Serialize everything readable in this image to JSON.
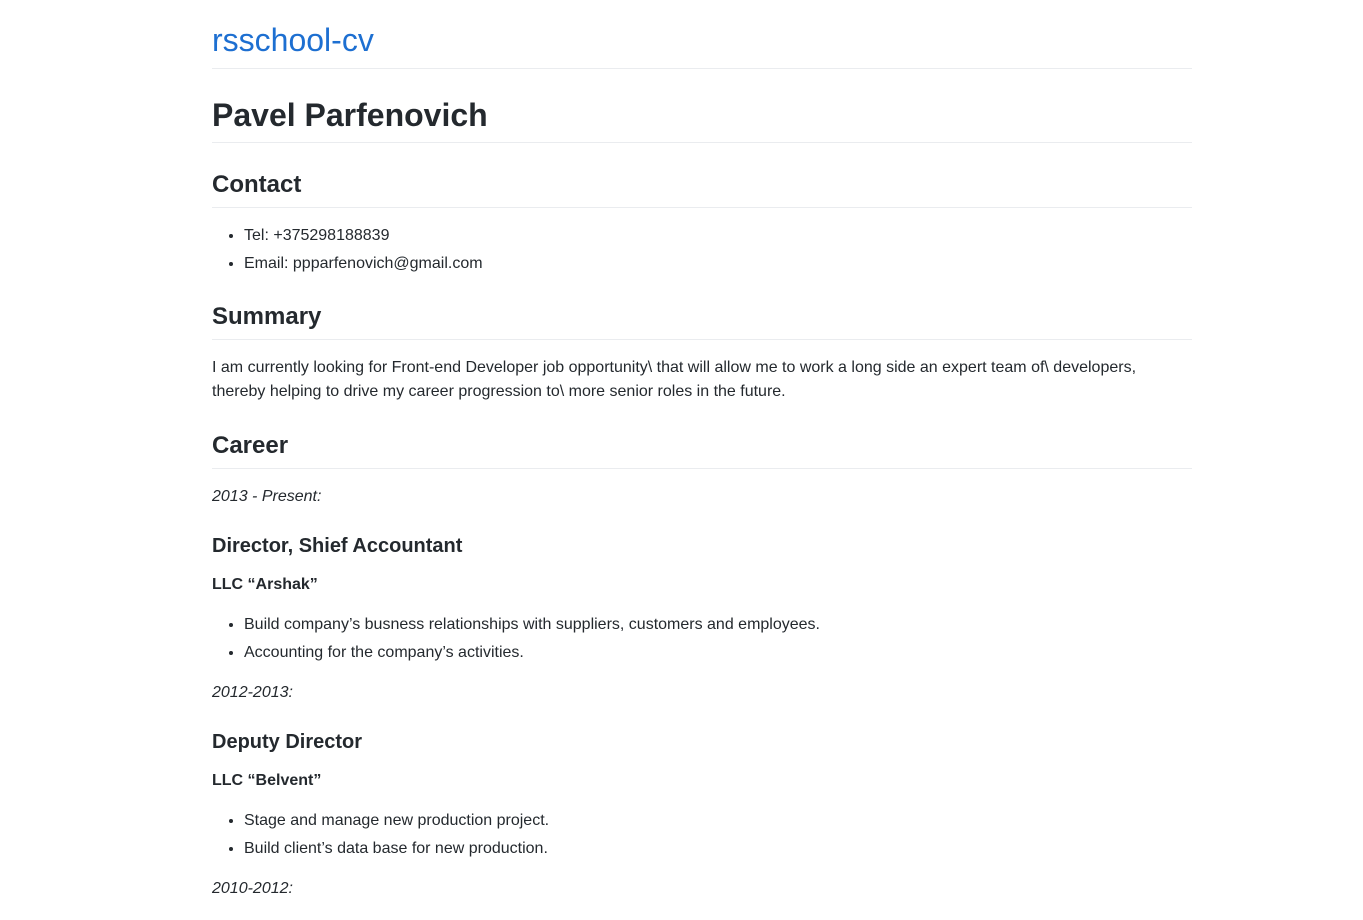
{
  "site": {
    "title": "rsschool-cv"
  },
  "name": "Pavel Parfenovich",
  "contact": {
    "heading": "Contact",
    "items": [
      "Tel: +375298188839",
      "Email: ppparfenovich@gmail.com"
    ]
  },
  "summary": {
    "heading": "Summary",
    "text": "I am currently looking for Front-end Developer job opportunity\\ that will allow me to work a long side an expert team of\\ developers, thereby helping to drive my career progression to\\ more senior roles in the future."
  },
  "career": {
    "heading": "Career",
    "jobs": [
      {
        "period": "2013 - Present:",
        "title": "Director, Shief Accountant",
        "company": "LLC “Arshak”",
        "duties": [
          "Build company’s busness relationships with suppliers, customers and employees.",
          "Accounting for the company’s activities."
        ]
      },
      {
        "period": "2012-2013:",
        "title": "Deputy Director",
        "company": "LLC “Belvent”",
        "duties": [
          "Stage and manage new production project.",
          "Build client’s data base for new production."
        ]
      },
      {
        "period": "2010-2012:"
      }
    ]
  }
}
